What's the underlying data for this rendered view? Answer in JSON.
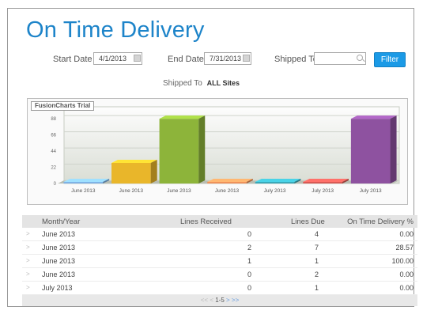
{
  "header": {
    "title": "On Time Delivery"
  },
  "filters": {
    "start_label": "Start Date",
    "start_value": "4/1/2013",
    "end_label": "End Date",
    "end_value": "7/31/2013",
    "shipped_label": "Shipped To",
    "shipped_value": "",
    "filter_button": "Filter"
  },
  "summary": {
    "label": "Shipped To",
    "value": "ALL Sites"
  },
  "chart": {
    "trial_label": "FusionCharts Trial"
  },
  "chart_data": {
    "type": "bar",
    "categories": [
      "June 2013",
      "June 2013",
      "June 2013",
      "June 2013",
      "July 2013",
      "July 2013",
      "July 2013"
    ],
    "values": [
      0,
      28,
      88,
      0,
      0,
      0,
      88
    ],
    "yticks": [
      "0",
      "22",
      "44",
      "66",
      "88"
    ],
    "colors": [
      "#7fb3e6",
      "#e9b62a",
      "#8db43a",
      "#f0925a",
      "#3aa9b9",
      "#d95a55",
      "#8e52a0"
    ],
    "ylim": [
      0,
      100
    ],
    "style": "3d-column"
  },
  "table": {
    "headers": [
      "Month/Year",
      "Lines Received",
      "Lines Due",
      "On Time Delivery %"
    ],
    "rows": [
      [
        "June 2013",
        "0",
        "4",
        "0.00"
      ],
      [
        "June 2013",
        "2",
        "7",
        "28.57"
      ],
      [
        "June 2013",
        "1",
        "1",
        "100.00"
      ],
      [
        "June 2013",
        "0",
        "2",
        "0.00"
      ],
      [
        "July 2013",
        "0",
        "1",
        "0.00"
      ]
    ]
  },
  "pager": {
    "first": "<<",
    "prev": "<",
    "range": "1-5",
    "next": ">",
    "last": ">>"
  }
}
